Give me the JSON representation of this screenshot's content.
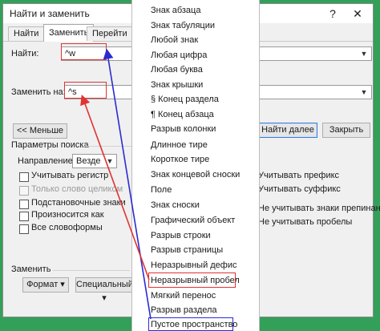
{
  "window": {
    "title": "Найти и заменить",
    "help_glyph": "?",
    "close_glyph": "✕"
  },
  "tabs": [
    {
      "label": "Найти"
    },
    {
      "label": "Заменить"
    },
    {
      "label": "Перейти"
    }
  ],
  "find": {
    "label": "Найти:",
    "value": "^w"
  },
  "replace": {
    "label": "Заменить на:",
    "value": "^s"
  },
  "buttons": {
    "less": "<< Меньше",
    "find_next": "Найти далее",
    "close": "Закрыть",
    "format": "Формат ▾",
    "special": "Специальный ▾"
  },
  "options": {
    "section_title": "Параметры поиска",
    "direction_label": "Направление:",
    "direction_value": "Везде",
    "left": [
      {
        "label": "Учитывать регистр",
        "checked": false,
        "disabled": false
      },
      {
        "label": "Только слово целиком",
        "checked": false,
        "disabled": true
      },
      {
        "label": "Подстановочные знаки",
        "checked": false,
        "disabled": false
      },
      {
        "label": "Произносится как",
        "checked": false,
        "disabled": false
      },
      {
        "label": "Все словоформы",
        "checked": false,
        "disabled": false
      }
    ],
    "right": [
      {
        "label": "Учитывать префикс"
      },
      {
        "label": "Учитывать суффикс"
      },
      {
        "label": "Не учитывать знаки препинания"
      },
      {
        "label": "Не учитывать пробелы"
      }
    ]
  },
  "replace_section": {
    "title": "Заменить"
  },
  "special_menu": {
    "items": [
      "Знак абзаца",
      "Знак табуляции",
      "Любой знак",
      "Любая цифра",
      "Любая буква",
      "Знак крышки",
      "§ Конец раздела",
      "¶ Конец абзаца",
      "Разрыв колонки",
      "Длинное тире",
      "Короткое тире",
      "Знак концевой сноски",
      "Поле",
      "Знак сноски",
      "Графический объект",
      "Разрыв строки",
      "Разрыв страницы",
      "Неразрывный дефис",
      "Неразрывный пробел",
      "Мягкий перенос",
      "Разрыв раздела",
      "Пустое пространство"
    ]
  },
  "colors": {
    "background": "#33a05a",
    "highlight_red": "#e03333",
    "highlight_blue": "#2b2bd0",
    "primary_button_border": "#3a7bd5"
  }
}
